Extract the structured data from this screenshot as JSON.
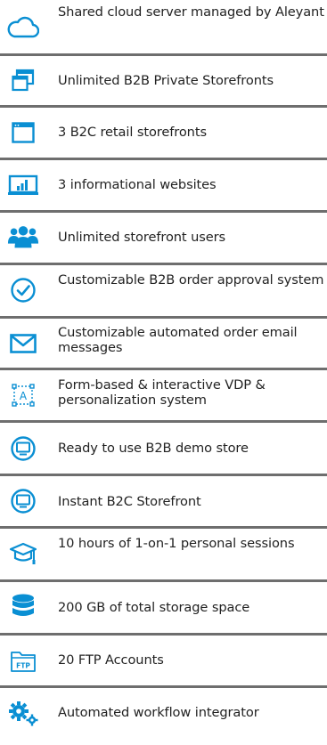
{
  "colors": {
    "icon_blue": "#0a8fd3",
    "text": "#222222",
    "divider": "#6e6e6e"
  },
  "features": [
    {
      "icon": "cloud-icon",
      "text": "Shared cloud server managed by Aleyant"
    },
    {
      "icon": "windows-icon",
      "text": "Unlimited B2B Private Storefronts"
    },
    {
      "icon": "browser-window-icon",
      "text": "3 B2C retail storefronts"
    },
    {
      "icon": "bar-chart-icon",
      "text": "3 informational websites"
    },
    {
      "icon": "users-icon",
      "text": "Unlimited storefront users"
    },
    {
      "icon": "checkmark-circle-icon",
      "text": "Customizable B2B order approval system"
    },
    {
      "icon": "envelope-icon",
      "text": "Customizable automated order email messages"
    },
    {
      "icon": "vdp-text-frame-icon",
      "text": "Form-based & interactive VDP & personalization system"
    },
    {
      "icon": "monitor-circle-icon",
      "text": "Ready to use B2B demo store"
    },
    {
      "icon": "monitor-circle-icon",
      "text": "Instant B2C Storefront"
    },
    {
      "icon": "graduation-cap-icon",
      "text": "10 hours of 1-on-1 personal sessions"
    },
    {
      "icon": "database-icon",
      "text": "200 GB of total storage space"
    },
    {
      "icon": "ftp-folder-icon",
      "text": "20 FTP Accounts"
    },
    {
      "icon": "gears-icon",
      "text": "Automated workflow integrator"
    }
  ],
  "ftp_icon_label": "FTP",
  "vdp_icon_label": "A"
}
